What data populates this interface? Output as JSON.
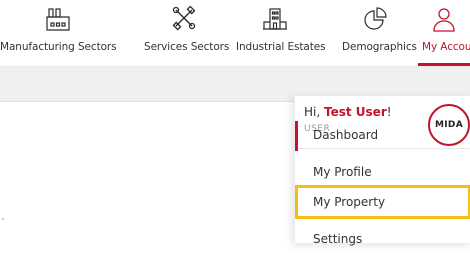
{
  "nav": {
    "items": [
      {
        "label": "Manufacturing Sectors",
        "icon": "factory-icon"
      },
      {
        "label": "Services Sectors",
        "icon": "tools-icon"
      },
      {
        "label": "Industrial Estates",
        "icon": "industrial-building-icon"
      },
      {
        "label": "Demographics",
        "icon": "pie-chart-icon"
      },
      {
        "label": "My Accoun",
        "icon": "user-icon"
      }
    ],
    "active_index": 4
  },
  "account_menu": {
    "greeting_prefix": "Hi, ",
    "user_name": "Test User",
    "greeting_suffix": "!",
    "role": "USER",
    "logo_text": "MIDA",
    "items": [
      {
        "label": "Dashboard"
      },
      {
        "label": "My Profile"
      },
      {
        "label": "My Property"
      },
      {
        "label": "Settings"
      }
    ]
  },
  "colors": {
    "accent": "#c4122f",
    "highlight": "#f4bf13",
    "background_strip": "#f0f0f0"
  }
}
